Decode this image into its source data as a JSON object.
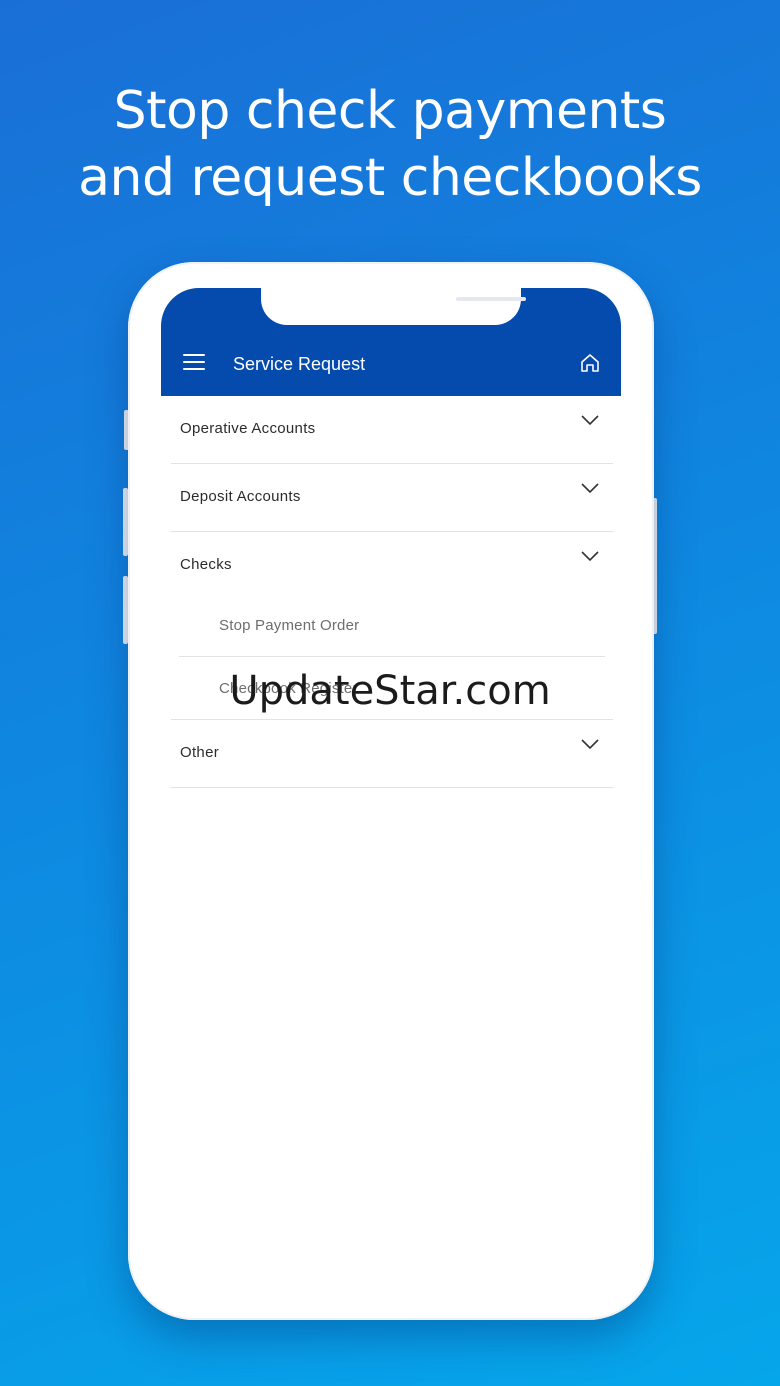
{
  "headline": {
    "line1": "Stop check payments",
    "line2": "and request checkbooks"
  },
  "appbar": {
    "title": "Service Request",
    "menu_icon": "hamburger-menu-icon",
    "home_icon": "home-icon"
  },
  "sections": [
    {
      "label": "Operative Accounts",
      "expanded": false
    },
    {
      "label": "Deposit Accounts",
      "expanded": false
    },
    {
      "label": "Checks",
      "expanded": true,
      "items": [
        "Stop Payment Order",
        "Checkbook Register"
      ]
    },
    {
      "label": "Other",
      "expanded": false
    }
  ],
  "watermark": "UpdateStar.com",
  "colors": {
    "appbar": "#054aad",
    "background_top": "#1a6fd6",
    "background_bottom": "#06a6ea"
  }
}
